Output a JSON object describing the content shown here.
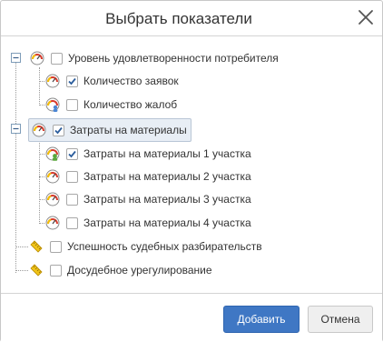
{
  "dialog": {
    "title": "Выбрать показатели",
    "close_icon": "close-icon"
  },
  "tree": {
    "nodes": [
      {
        "label": "Уровень удовлетворенности потребителя",
        "checked": false,
        "icon": "gauge-icon",
        "expanded": true
      },
      {
        "label": "Количество заявок",
        "checked": true,
        "icon": "gauge-icon"
      },
      {
        "label": "Количество жалоб",
        "checked": false,
        "icon": "gauge-user-icon"
      },
      {
        "label": "Затраты на материалы",
        "checked": true,
        "icon": "gauge-icon",
        "expanded": true,
        "selected": true
      },
      {
        "label": "Затраты на материалы 1 участка",
        "checked": true,
        "icon": "gauge-user-icon"
      },
      {
        "label": "Затраты на материалы 2 участка",
        "checked": false,
        "icon": "gauge-icon"
      },
      {
        "label": "Затраты на материалы 3 участка",
        "checked": false,
        "icon": "gauge-icon"
      },
      {
        "label": "Затраты на материалы 4 участка",
        "checked": false,
        "icon": "gauge-icon"
      },
      {
        "label": "Успешность судебных разбирательств",
        "checked": false,
        "icon": "ruler-icon"
      },
      {
        "label": "Досудебное урегулирование",
        "checked": false,
        "icon": "ruler-icon"
      }
    ]
  },
  "footer": {
    "add_label": "Добавить",
    "cancel_label": "Отмена"
  },
  "colors": {
    "primary_button": "#3f77c4",
    "secondary_button": "#efefef",
    "selected_row": "#e8eef5"
  }
}
